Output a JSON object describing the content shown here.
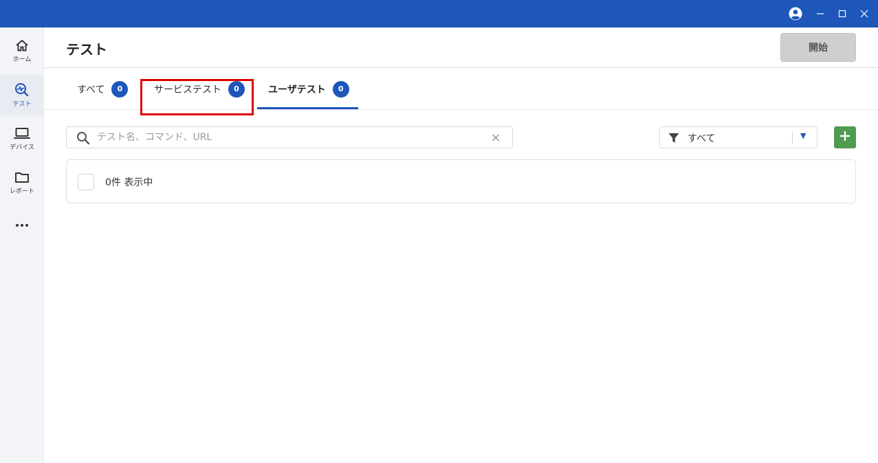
{
  "window": {
    "controls": [
      "account-icon",
      "minimize-icon",
      "maximize-icon",
      "close-icon"
    ]
  },
  "sidebar": {
    "items": [
      {
        "label": "ホーム",
        "icon": "home-icon",
        "active": false
      },
      {
        "label": "テスト",
        "icon": "test-icon",
        "active": true
      },
      {
        "label": "デバイス",
        "icon": "laptop-icon",
        "active": false
      },
      {
        "label": "レポート",
        "icon": "folder-icon",
        "active": false
      },
      {
        "label": "",
        "icon": "more-icon",
        "active": false
      }
    ]
  },
  "header": {
    "title": "テスト",
    "start_label": "開始"
  },
  "tabs": [
    {
      "label": "すべて",
      "count": "0",
      "selected": false
    },
    {
      "label": "サービステスト",
      "count": "0",
      "selected": false
    },
    {
      "label": "ユーザテスト",
      "count": "0",
      "selected": true
    }
  ],
  "search": {
    "placeholder": "テスト名、コマンド、URL",
    "value": "",
    "clear": "×"
  },
  "filter": {
    "selected": "すべて"
  },
  "results": {
    "count_text": "0件 表示中"
  },
  "colors": {
    "titlebar": "#1e56b9",
    "accent": "#1e56b9",
    "add_button": "#4f9b4f",
    "highlight": "#e00000"
  }
}
